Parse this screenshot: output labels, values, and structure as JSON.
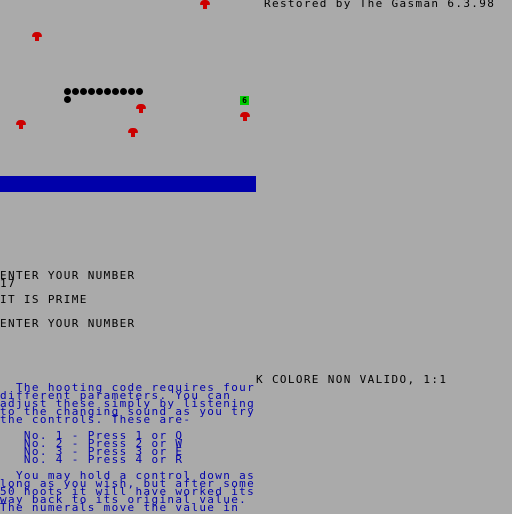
{
  "header": {
    "credit": "Restored by The Gasman 6.3.98"
  },
  "game": {
    "snake_segments": 11,
    "bonus_value": "6",
    "colors": {
      "background": "#aaaaaa",
      "mushroom": "#cc0000",
      "snake": "#000000",
      "bonus": "#00cc00",
      "bar": "#0000aa"
    }
  },
  "console": {
    "prompt1": "ENTER YOUR NUMBER",
    "input1": "17",
    "result1": "IT IS PRIME",
    "prompt2": "ENTER YOUR NUMBER"
  },
  "status": {
    "error": "K COLORE NON VALIDO, 1:1"
  },
  "instructions": {
    "para1": [
      "  The hooting code requires four",
      "different parameters. You can",
      "adjust these simply by listening",
      "to the changing sound as you try",
      "the controls. These are-"
    ],
    "controls": [
      "   No. 1 - Press 1 or Q",
      "   No. 2 - Press 2 or W",
      "   No. 3 - Press 3 or E",
      "   No. 4 - Press 4 or R"
    ],
    "para2": [
      "  You may hold a control down as",
      "long as you wish, but after some",
      "50 hoots it will have worked its",
      "way back to its original value.",
      "The numerals move the value in"
    ]
  }
}
